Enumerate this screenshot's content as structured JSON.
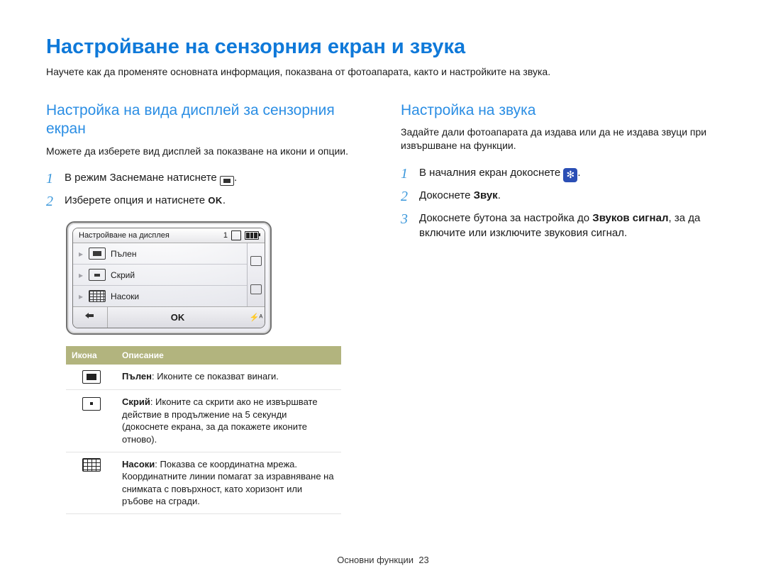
{
  "title": "Настройване на сензорния екран и звука",
  "intro": "Научете как да променяте основната информация, показвана от фотоапарата, както и настройките на звука.",
  "left": {
    "heading": "Настройка на вида дисплей за сензорния екран",
    "desc": "Можете да изберете вид дисплей за показване на икони и опции.",
    "step1_pre": "В режим Заснемане натиснете ",
    "step2_pre": "Изберете опция и натиснете ",
    "lcd": {
      "title": "Настройване на дисплея",
      "count": "1",
      "opt_full": "Пълен",
      "opt_hide": "Скрий",
      "opt_grid": "Насоки",
      "ok": "OK"
    },
    "table": {
      "h1": "Икона",
      "h2": "Описание",
      "r1b": "Пълен",
      "r1t": ": Иконите се показват винаги.",
      "r2b": "Скрий",
      "r2t": ": Иконите са скрити ако не извършвате действие в продължение на 5 секунди (докоснете екрана, за да покажете иконите отново).",
      "r3b": "Насоки",
      "r3t": ": Показва се координатна мрежа. Координатните линии помагат за изравняване на снимката с повърхност, като хоризонт или ръбове на сгради."
    }
  },
  "right": {
    "heading": "Настройка на звука",
    "desc": "Задайте дали фотоапарата да издава или да не издава звуци при извършване на функции.",
    "step1_pre": "В началния екран докоснете ",
    "step2_pre": "Докоснете ",
    "step2_b": "Звук",
    "step3_pre": "Докоснете бутона за настройка до ",
    "step3_b": "Звуков сигнал",
    "step3_post": ", за да включите или изключите звуковия сигнал."
  },
  "footer": {
    "label": "Основни функции",
    "page": "23"
  }
}
